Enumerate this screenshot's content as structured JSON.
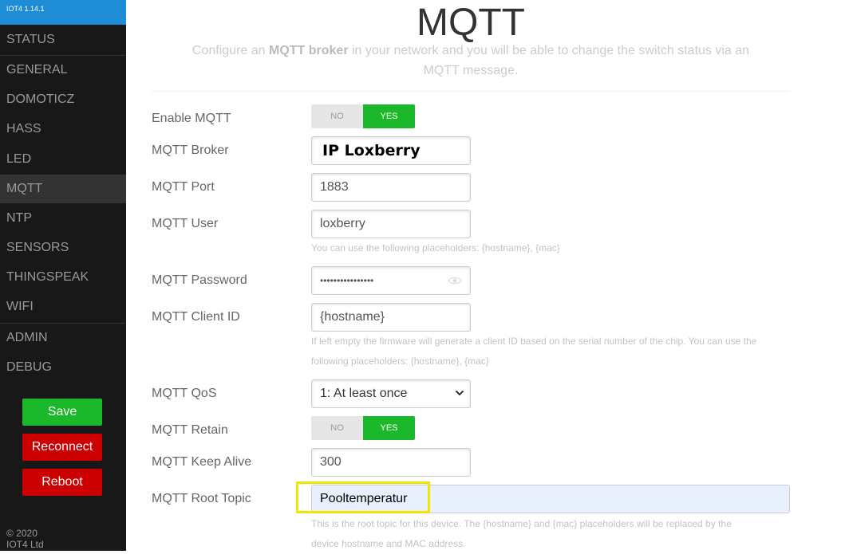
{
  "sidebar": {
    "version": "IOT4 1.14.1",
    "items": [
      {
        "label": "STATUS"
      },
      {
        "label": "GENERAL"
      },
      {
        "label": "DOMOTICZ"
      },
      {
        "label": "HASS"
      },
      {
        "label": "LED"
      },
      {
        "label": "MQTT"
      },
      {
        "label": "NTP"
      },
      {
        "label": "SENSORS"
      },
      {
        "label": "THINGSPEAK"
      },
      {
        "label": "WIFI"
      },
      {
        "label": "ADMIN"
      },
      {
        "label": "DEBUG"
      }
    ],
    "active_item": "MQTT",
    "buttons": {
      "save": "Save",
      "reconnect": "Reconnect",
      "reboot": "Reboot"
    },
    "copyright_line1": "© 2020",
    "copyright_line2": "IOT4 Ltd"
  },
  "page": {
    "title": "MQTT",
    "subtitle_pre": "Configure an ",
    "subtitle_bold": "MQTT broker",
    "subtitle_post": " in your network and you will be able to change the switch status via an MQTT message."
  },
  "form": {
    "enable": {
      "label": "Enable MQTT",
      "no": "NO",
      "yes": "YES",
      "value": "YES"
    },
    "broker": {
      "label": "MQTT Broker",
      "value": "IP Loxberry"
    },
    "port": {
      "label": "MQTT Port",
      "value": "1883"
    },
    "user": {
      "label": "MQTT User",
      "value": "loxberry",
      "hint": "You can use the following placeholders: {hostname}, {mac}"
    },
    "password": {
      "label": "MQTT Password",
      "value": "••••••••••••••••"
    },
    "client_id": {
      "label": "MQTT Client ID",
      "value": "{hostname}",
      "hint_line1": "If left empty the firmware will generate a client ID based on the serial number of the chip. You can use the",
      "hint_line2": "following placeholders: {hostname}, {mac}"
    },
    "qos": {
      "label": "MQTT QoS",
      "value": "1: At least once"
    },
    "retain": {
      "label": "MQTT Retain",
      "no": "NO",
      "yes": "YES",
      "value": "YES"
    },
    "keep_alive": {
      "label": "MQTT Keep Alive",
      "value": "300"
    },
    "root_topic": {
      "label": "MQTT Root Topic",
      "value": "Pooltemperatur",
      "hint_line1": "This is the root topic for this device. The {hostname} and {mac} placeholders will be replaced by the",
      "hint_line2": "device hostname and MAC address."
    }
  },
  "colors": {
    "accent_blue": "#1f8dd6",
    "green": "#1cb82b",
    "red": "#cc0000",
    "highlight": "#f2e500",
    "sidebar_bg": "#191818"
  }
}
